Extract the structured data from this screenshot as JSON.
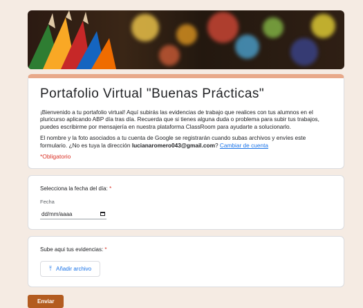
{
  "form": {
    "title": "Portafolio Virtual \"Buenas Prácticas\"",
    "description": "¡Bienvenido a tu portafolio virtual! Aquí subirás las evidencias de trabajo que realices con tus alumnos en el pluricurso aplicando ABP día tras día. Recuerda que si tienes alguna duda o problema para subir tus trabajos, puedes  escribirme  por mensajería en nuestra plataforma ClassRoom para ayudarte a solucionarlo.",
    "account_text_before": "El nombre y la foto asociados a tu cuenta de Google se registrarán cuando subas archivos y envíes este formulario. ¿No es tuya la dirección ",
    "account_email": "lucianaromero043@gmail.com",
    "account_text_after": "? ",
    "change_account_link": "Cambiar de cuenta",
    "required_note": "*Obligatorio"
  },
  "questions": {
    "date": {
      "label": "Selecciona la fecha del día: ",
      "star": "*",
      "sublabel": "Fecha",
      "placeholder": "dd/mm/aaaa"
    },
    "upload": {
      "label": "Sube aqui tus evidencias: ",
      "star": "*",
      "button_label": "Añadir archivo",
      "button_icon": "upload-icon"
    }
  },
  "submit_label": "Enviar",
  "colors": {
    "accent": "#e8a98a",
    "submit": "#b35c20",
    "link": "#1a73e8",
    "required": "#d93025",
    "background": "#f5ebe3"
  }
}
